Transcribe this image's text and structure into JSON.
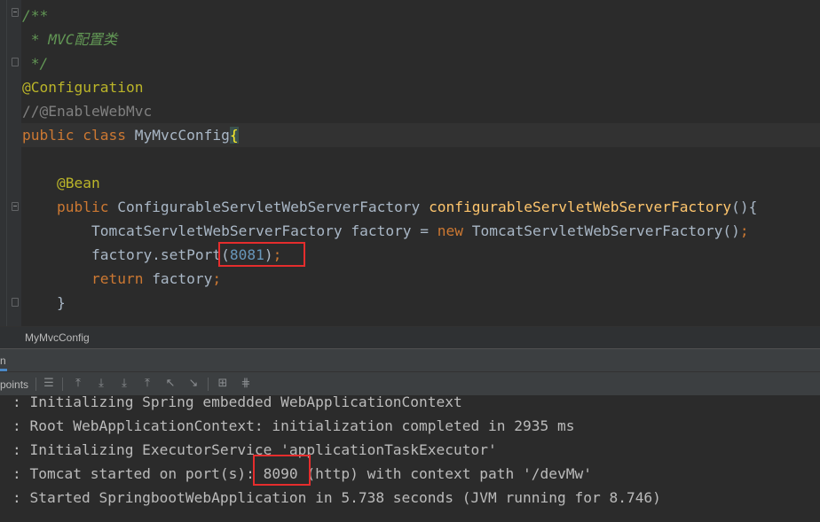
{
  "editor": {
    "lines": [
      {
        "segments": [
          {
            "text": "/**",
            "cls": "comment"
          }
        ]
      },
      {
        "segments": [
          {
            "text": " * MVC配置类",
            "cls": "comment"
          }
        ]
      },
      {
        "segments": [
          {
            "text": " */",
            "cls": "comment"
          }
        ]
      },
      {
        "segments": [
          {
            "text": "@Configuration",
            "cls": "anno"
          }
        ]
      },
      {
        "segments": [
          {
            "text": "//@EnableWebMvc",
            "cls": "lcomment"
          }
        ]
      },
      {
        "segments": [
          {
            "text": "public class ",
            "cls": "kw"
          },
          {
            "text": "MyMvcConfig",
            "cls": ""
          },
          {
            "text": "{",
            "cls": "brace-hl"
          }
        ]
      },
      {
        "segments": [
          {
            "text": "",
            "cls": ""
          }
        ]
      },
      {
        "segments": [
          {
            "text": "    @Bean",
            "cls": "anno"
          }
        ]
      },
      {
        "segments": [
          {
            "text": "    public ",
            "cls": "kw"
          },
          {
            "text": "ConfigurableServletWebServerFactory ",
            "cls": ""
          },
          {
            "text": "configurableServletWebServerFactory",
            "cls": "method"
          },
          {
            "text": "(){",
            "cls": ""
          }
        ]
      },
      {
        "segments": [
          {
            "text": "        TomcatServletWebServerFactory factory = ",
            "cls": ""
          },
          {
            "text": "new ",
            "cls": "kw"
          },
          {
            "text": "TomcatServletWebServerFactory()",
            "cls": ""
          },
          {
            "text": ";",
            "cls": "kw"
          }
        ]
      },
      {
        "segments": [
          {
            "text": "        factory.setPort(",
            "cls": ""
          },
          {
            "text": "8081",
            "cls": "num"
          },
          {
            "text": ")",
            "cls": ""
          },
          {
            "text": ";",
            "cls": "kw"
          }
        ]
      },
      {
        "segments": [
          {
            "text": "        return ",
            "cls": "kw"
          },
          {
            "text": "factory",
            "cls": ""
          },
          {
            "text": ";",
            "cls": "kw"
          }
        ]
      },
      {
        "segments": [
          {
            "text": "    }",
            "cls": ""
          }
        ]
      }
    ]
  },
  "breadcrumb": {
    "label": "MyMvcConfig"
  },
  "run_panel": {
    "tab_label": "n",
    "toolbar_label": "points"
  },
  "console": {
    "lines": [
      ": Initializing Spring embedded WebApplicationContext",
      ": Root WebApplicationContext: initialization completed in 2935 ms",
      ": Initializing ExecutorService 'applicationTaskExecutor'",
      ": Tomcat started on port(s): 8090 (http) with context path '/devMw'",
      ": Started SpringbootWebApplication in 5.738 seconds (JVM running for 8.746)"
    ]
  },
  "colors": {
    "editor_bg": "#2b2b2b",
    "keyword": "#cc7832",
    "annotation": "#bbb529",
    "doc_comment": "#629755",
    "method": "#ffc66d",
    "number": "#6897bb",
    "highlight_box": "#e52d2d"
  }
}
